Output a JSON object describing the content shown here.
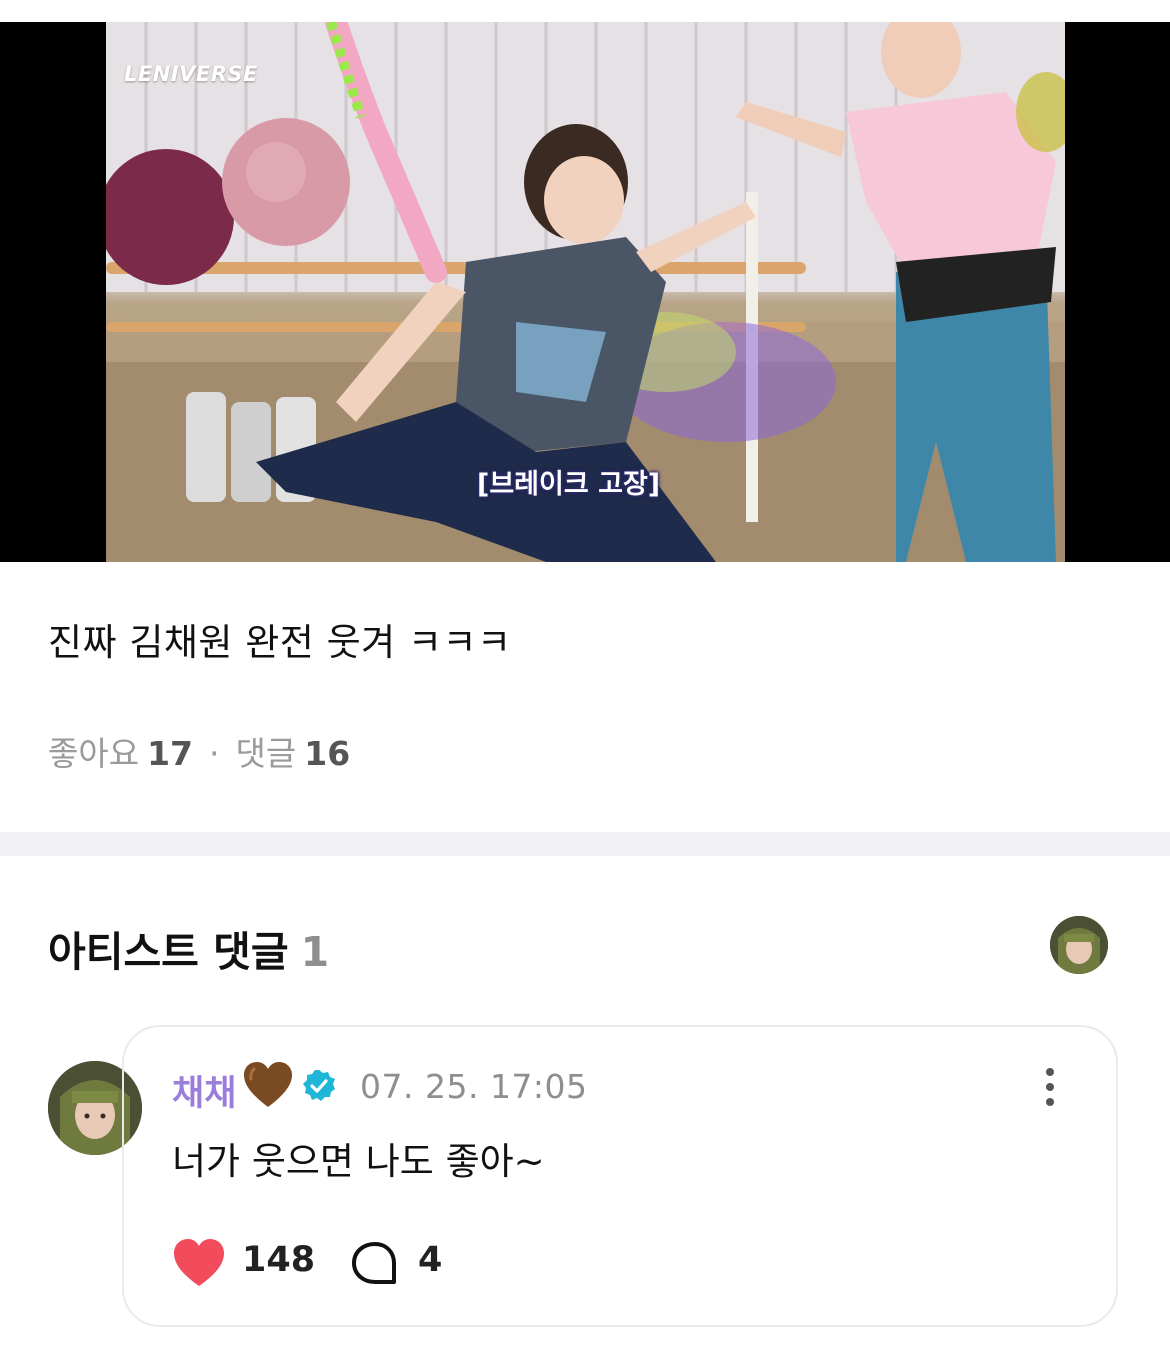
{
  "media": {
    "logo": "LENIVERSE",
    "subtitle": "[브레이크 고장]"
  },
  "post": {
    "text": "진짜 김채원 완전 웃겨 ㅋㅋㅋ",
    "likes_label": "좋아요",
    "likes_count": "17",
    "separator": "·",
    "comments_label": "댓글",
    "comments_count": "16"
  },
  "artist_comments": {
    "title": "아티스트 댓글",
    "count": "1",
    "comment": {
      "author": "채채",
      "author_emoji": "brown-heart-icon",
      "verified_icon": "verified-badge-icon",
      "timestamp": "07. 25. 17:05",
      "body": "너가 웃으면 나도 좋아~",
      "like_count": "148",
      "reply_count": "4"
    }
  },
  "colors": {
    "author_name": "#9b7ddb",
    "verified": "#1fb6d8",
    "like_heart": "#f24b5b",
    "brown_heart": "#7a4a22",
    "divider": "#f2f2f4"
  }
}
